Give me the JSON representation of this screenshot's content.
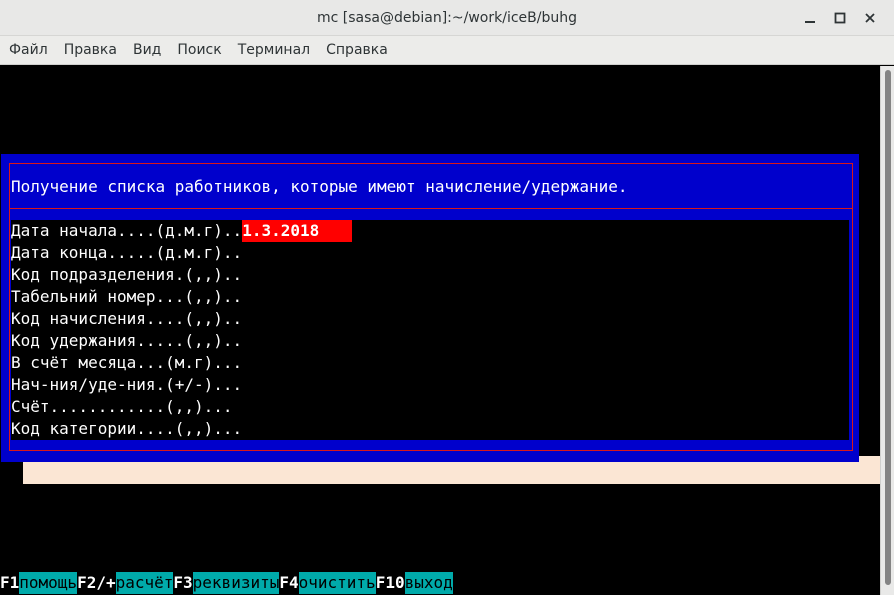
{
  "window": {
    "title": "mc [sasa@debian]:~/work/iceB/buhg"
  },
  "menubar": {
    "items": [
      {
        "label": "Файл"
      },
      {
        "label": "Правка"
      },
      {
        "label": "Вид"
      },
      {
        "label": "Поиск"
      },
      {
        "label": "Терминал"
      },
      {
        "label": "Справка"
      }
    ]
  },
  "dialog": {
    "title": "Получение списка работников, которые имеют начисление/удержание.",
    "fields": [
      {
        "label": "Дата начала....(д.м.г)..",
        "value": "1.3.2018"
      },
      {
        "label": "Дата конца.....(д.м.г)..",
        "value": ""
      },
      {
        "label": "Код подразделения.(,,)..",
        "value": ""
      },
      {
        "label": "Табельний номер...(,,)..",
        "value": ""
      },
      {
        "label": "Код начисления....(,,)..",
        "value": ""
      },
      {
        "label": "Код удержания.....(,,)..",
        "value": ""
      },
      {
        "label": "В счёт месяца...(м.г)...",
        "value": ""
      },
      {
        "label": "Нач-ния/уде-ния.(+/-)...",
        "value": ""
      },
      {
        "label": "Счёт............(,,)...",
        "value": ""
      },
      {
        "label": "Код категории....(,,)...",
        "value": ""
      }
    ]
  },
  "fkeys": [
    {
      "key": "F1",
      "label": "помощь"
    },
    {
      "key": "F2/+",
      "label": "расчёт"
    },
    {
      "key": "F3",
      "label": "реквизиты"
    },
    {
      "key": "F4",
      "label": "очистить"
    },
    {
      "key": "F10",
      "label": "выход"
    }
  ],
  "colors": {
    "dialog_bg": "#0000cc",
    "frame": "#d81818",
    "active_field": "#ff0000",
    "fkey_label_bg": "#00aaaa",
    "backdrop": "#fbe6d4"
  }
}
